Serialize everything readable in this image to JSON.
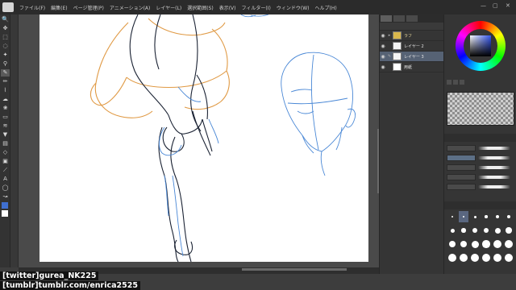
{
  "menubar": {
    "items": [
      "ファイル(F)",
      "編集(E)",
      "ページ管理(P)",
      "アニメーション(A)",
      "レイヤー(L)",
      "選択範囲(S)",
      "表示(V)",
      "フィルター(I)",
      "ウィンドウ(W)",
      "ヘルプ(H)"
    ],
    "window_controls": [
      "—",
      "▢",
      "✕"
    ]
  },
  "toolbar": {
    "tools": [
      {
        "icon": "zoom-icon",
        "glyph": "🔍"
      },
      {
        "icon": "move-icon",
        "glyph": "✥"
      },
      {
        "icon": "select-icon",
        "glyph": "⬚"
      },
      {
        "icon": "lasso-icon",
        "glyph": "◌"
      },
      {
        "icon": "wand-icon",
        "glyph": "✦"
      },
      {
        "icon": "eyedropper-icon",
        "glyph": "⚲"
      },
      {
        "icon": "pen-icon",
        "glyph": "✎",
        "active": true
      },
      {
        "icon": "pencil-icon",
        "glyph": "✏"
      },
      {
        "icon": "brush-icon",
        "glyph": "⌇"
      },
      {
        "icon": "airbrush-icon",
        "glyph": "☁"
      },
      {
        "icon": "decoration-icon",
        "glyph": "❀"
      },
      {
        "icon": "eraser-icon",
        "glyph": "▭"
      },
      {
        "icon": "blend-icon",
        "glyph": "≋"
      },
      {
        "icon": "fill-icon",
        "glyph": "▼"
      },
      {
        "icon": "gradient-icon",
        "glyph": "▤"
      },
      {
        "icon": "figure-icon",
        "glyph": "◇"
      },
      {
        "icon": "frame-icon",
        "glyph": "▣"
      },
      {
        "icon": "ruler-icon",
        "glyph": "⟋"
      },
      {
        "icon": "text-icon",
        "glyph": "A"
      },
      {
        "icon": "balloon-icon",
        "glyph": "◯"
      },
      {
        "icon": "line-correction-icon",
        "glyph": "↝"
      }
    ],
    "colors": [
      "#3f6fd0",
      "#ffffff"
    ]
  },
  "layers": {
    "items": [
      {
        "name": "ラフ",
        "type": "folder",
        "visible": true,
        "selected": false
      },
      {
        "name": "レイヤー 2",
        "type": "raster",
        "visible": true,
        "selected": false
      },
      {
        "name": "レイヤー 3",
        "type": "raster",
        "visible": true,
        "selected": true
      },
      {
        "name": "用紙",
        "type": "paper",
        "visible": true,
        "selected": false
      }
    ]
  },
  "colors": {
    "accent_blue": "#3f6fd0",
    "sketch_orange": "#e09a45",
    "sketch_blue": "#4a88d6",
    "ink_dark": "#1a2233"
  },
  "captions": {
    "twitter": "[twitter]gurea_NK225",
    "tumblr": "[tumblr]tumblr.com/enrica2525"
  }
}
